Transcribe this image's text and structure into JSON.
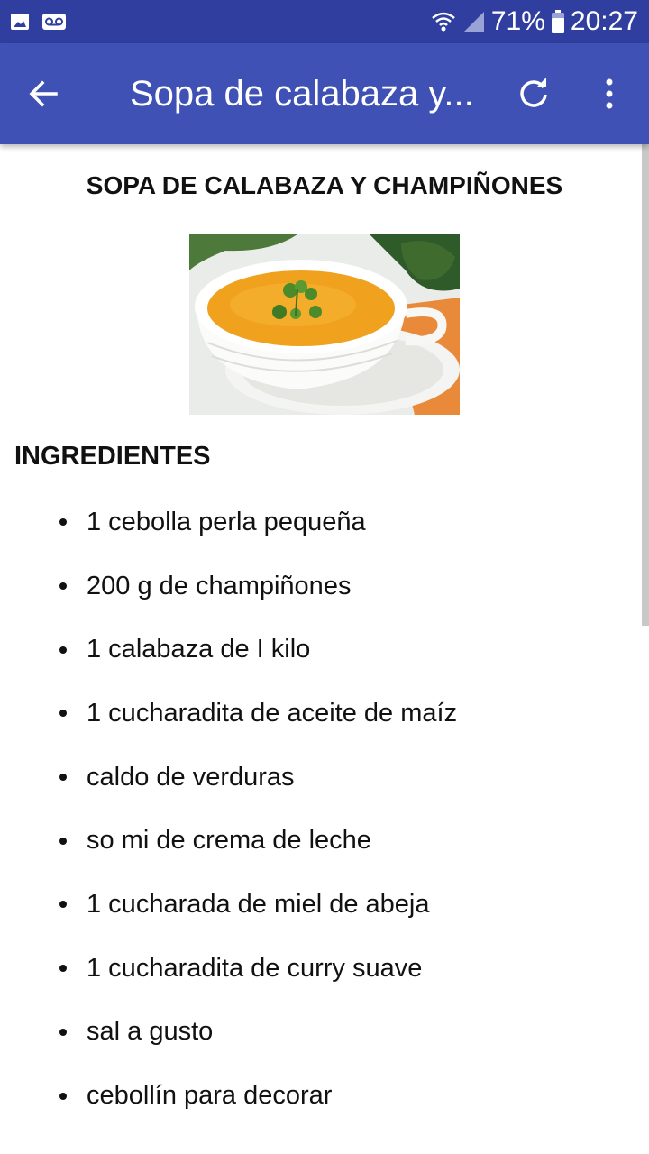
{
  "status_bar": {
    "battery_percent": "71%",
    "time": "20:27",
    "icons": [
      "image-icon",
      "voicemail-icon",
      "wifi-icon",
      "signal-icon",
      "battery-icon"
    ]
  },
  "app_bar": {
    "title": "Sopa de calabaza y...",
    "icons": [
      "back-arrow-icon",
      "refresh-icon",
      "more-vert-icon"
    ]
  },
  "recipe": {
    "title": "SOPA DE CALABAZA Y CHAMPIÑONES",
    "ingredients_heading": "INGREDIENTES",
    "ingredients": [
      "1 cebolla perla pequeña",
      "200 g de champiñones",
      "1 calabaza de I kilo",
      "1 cucharadita de aceite de maíz",
      "caldo de verduras",
      "so mi de crema de leche",
      "1 cucharada de miel de abeja",
      "1 cucharadita de curry suave",
      "sal a gusto",
      "cebollín para decorar"
    ]
  },
  "colors": {
    "status_bar": "#303f9f",
    "app_bar": "#3f51b5",
    "text": "#111111"
  }
}
